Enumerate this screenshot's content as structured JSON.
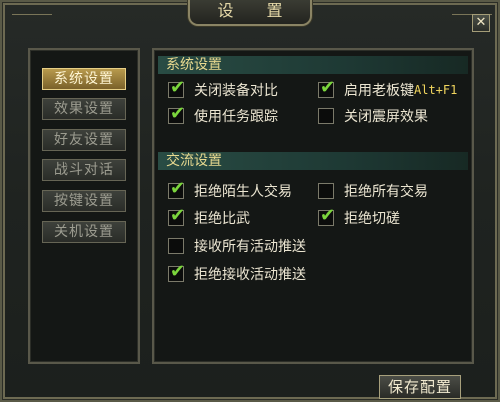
{
  "window": {
    "title": "设 置",
    "close_glyph": "✕"
  },
  "nav": {
    "items": [
      {
        "label": "系统设置",
        "active": true
      },
      {
        "label": "效果设置",
        "active": false
      },
      {
        "label": "好友设置",
        "active": false
      },
      {
        "label": "战斗对话",
        "active": false
      },
      {
        "label": "按键设置",
        "active": false
      },
      {
        "label": "关机设置",
        "active": false
      }
    ]
  },
  "system_settings": {
    "header": "系统设置",
    "options": [
      {
        "label": "关闭装备对比",
        "checked": true
      },
      {
        "label": "启用老板键",
        "hotkey": "Alt+F1",
        "checked": true
      },
      {
        "label": "使用任务跟踪",
        "checked": true
      },
      {
        "label": "关闭震屏效果",
        "checked": false
      }
    ]
  },
  "chat_settings": {
    "header": "交流设置",
    "options": [
      {
        "label": "拒绝陌生人交易",
        "checked": true
      },
      {
        "label": "拒绝所有交易",
        "checked": false
      },
      {
        "label": "拒绝比武",
        "checked": true
      },
      {
        "label": "拒绝切磋",
        "checked": true
      },
      {
        "label": "接收所有活动推送",
        "checked": false
      },
      {
        "label": "拒绝接收活动推送",
        "checked": true
      }
    ]
  },
  "footer": {
    "save_label": "保存配置"
  },
  "colors": {
    "check": "#7bd53c",
    "header_text": "#e7d98f",
    "active_nav": "#b89a4d"
  },
  "icons": {
    "check": "check-icon",
    "close": "close-icon"
  }
}
